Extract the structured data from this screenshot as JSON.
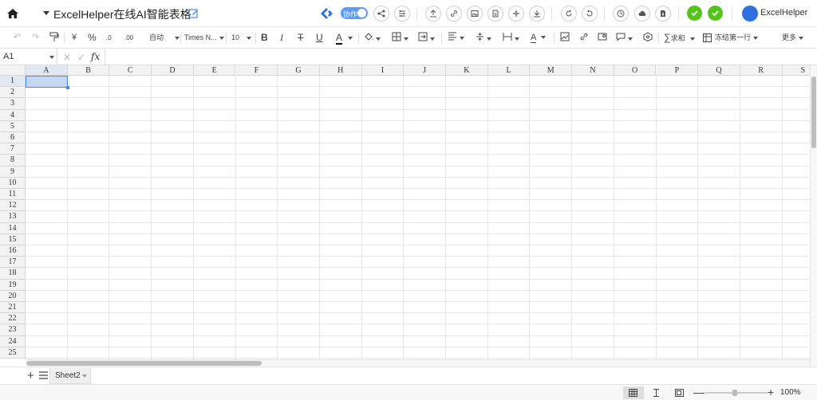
{
  "topbar": {
    "title": "ExcelHelper在线AI智能表格",
    "collab_label": "协作",
    "brand_name": "ExcelHelper"
  },
  "toolbar": {
    "currency_symbol": "¥",
    "percent_symbol": "%",
    "decimal_decrease": ".0",
    "decimal_increase": ".00",
    "number_format": "自动",
    "font_family": "Times N...",
    "font_size": "10",
    "bold": "B",
    "italic": "I",
    "strike": "T",
    "underline": "U",
    "font_color": "A",
    "text_color_glyph": "A",
    "sum_label": "求和",
    "freeze_label": "冻结第一行",
    "more_label": "更多"
  },
  "formula_bar": {
    "cell_ref": "A1",
    "cancel_glyph": "✕",
    "confirm_glyph": "✓",
    "fx_label": "fx",
    "formula_value": ""
  },
  "grid": {
    "columns": [
      "A",
      "B",
      "C",
      "D",
      "E",
      "F",
      "G",
      "H",
      "I",
      "J",
      "K",
      "L",
      "M",
      "N",
      "O",
      "P",
      "Q",
      "R",
      "S"
    ],
    "rows": [
      "1",
      "2",
      "3",
      "4",
      "5",
      "6",
      "7",
      "8",
      "9",
      "10",
      "11",
      "12",
      "13",
      "14",
      "15",
      "16",
      "17",
      "18",
      "19",
      "20",
      "21",
      "22",
      "23",
      "24",
      "25"
    ],
    "selected_cell": "A1"
  },
  "sheets": {
    "add_glyph": "+",
    "tabs": [
      "Sheet2"
    ]
  },
  "status": {
    "zoom": "100%",
    "zoom_minus": "—",
    "zoom_plus": "+"
  },
  "colors": {
    "accent": "#4a86e8",
    "selection_fill": "#c5d8f3",
    "confirm_green": "#52c41a"
  },
  "icons": [
    "home-icon",
    "edit-icon",
    "share-icon",
    "settings-icon",
    "upload-icon",
    "link-icon",
    "image-icon",
    "document-icon",
    "magic-icon",
    "download-icon",
    "refresh-icon",
    "redo-icon",
    "history-icon",
    "cloud-icon",
    "export-icon",
    "check-icon",
    "undo-icon",
    "format-painter-icon",
    "fill-icon",
    "border-icon",
    "merge-icon",
    "align-icon",
    "valign-icon",
    "wrap-icon",
    "chart-icon",
    "comment-icon",
    "filter-icon",
    "sum-icon",
    "freeze-icon",
    "list-icon",
    "grid-view-icon",
    "page-break-icon",
    "page-layout-icon"
  ]
}
